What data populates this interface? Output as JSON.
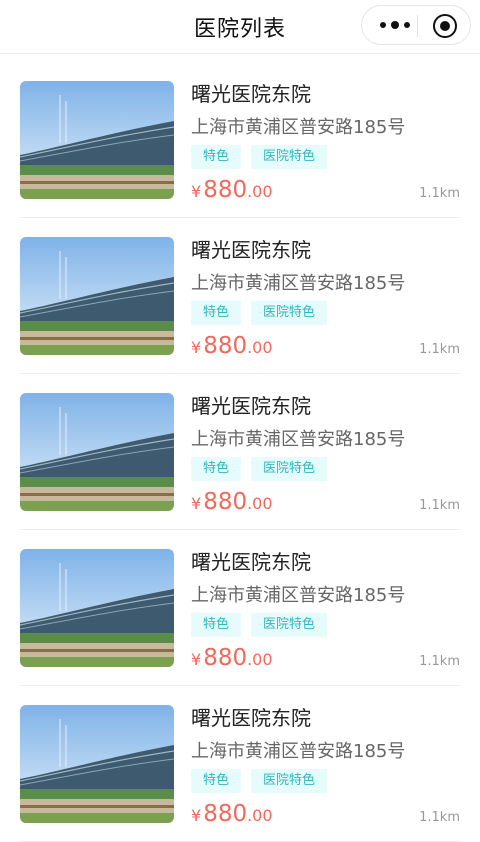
{
  "header": {
    "title": "医院列表",
    "more_icon": "more-dots-icon",
    "close_icon": "target-icon"
  },
  "hospitals": [
    {
      "name": "曙光医院东院",
      "address": "上海市黄浦区普安路185号",
      "tags": [
        "特色",
        "医院特色"
      ],
      "currency": "¥",
      "price_int": "880",
      "price_dec": ".00",
      "distance": "1.1km"
    },
    {
      "name": "曙光医院东院",
      "address": "上海市黄浦区普安路185号",
      "tags": [
        "特色",
        "医院特色"
      ],
      "currency": "¥",
      "price_int": "880",
      "price_dec": ".00",
      "distance": "1.1km"
    },
    {
      "name": "曙光医院东院",
      "address": "上海市黄浦区普安路185号",
      "tags": [
        "特色",
        "医院特色"
      ],
      "currency": "¥",
      "price_int": "880",
      "price_dec": ".00",
      "distance": "1.1km"
    },
    {
      "name": "曙光医院东院",
      "address": "上海市黄浦区普安路185号",
      "tags": [
        "特色",
        "医院特色"
      ],
      "currency": "¥",
      "price_int": "880",
      "price_dec": ".00",
      "distance": "1.1km"
    },
    {
      "name": "曙光医院东院",
      "address": "上海市黄浦区普安路185号",
      "tags": [
        "特色",
        "医院特色"
      ],
      "currency": "¥",
      "price_int": "880",
      "price_dec": ".00",
      "distance": "1.1km"
    }
  ],
  "colors": {
    "price": "#f2695b",
    "tag_text": "#2db7c0",
    "tag_bg": "#e6fbfb"
  }
}
